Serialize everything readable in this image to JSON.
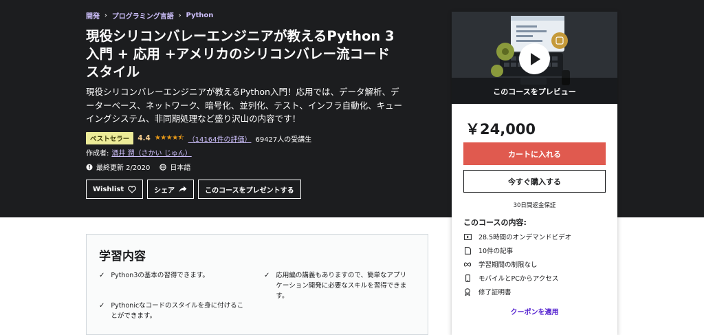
{
  "breadcrumb": [
    "開発",
    "プログラミング言語",
    "Python"
  ],
  "course": {
    "title_lines": [
      "現役シリコンバレーエンジニアが教えるPython 3",
      "入門 + 応用 +アメリカのシリコンバレー流コード",
      "スタイル"
    ],
    "subtitle_lines": [
      "現役シリコンバレーエンジニアが教えるPython入門！応用では、データ解析、デ",
      "ーターベース、ネットワーク、暗号化、並列化、テスト、インフラ自動化、キュー",
      "イングシステム、非同期処理など盛り沢山の内容です！"
    ],
    "badge": "ベストセラー",
    "rating": "4.4",
    "stars": "★★★★⯪",
    "reviews": "（14164件の評価）",
    "students": "69427人の受講生",
    "author_label": "作成者:",
    "author": "酒井 潤（さかい じゅん）",
    "updated": "最終更新 2/2020",
    "language": "日本語"
  },
  "actions": {
    "wishlist": "Wishlist",
    "share": "シェア",
    "gift": "このコースをプレゼントする"
  },
  "learn": {
    "title": "学習内容",
    "items": [
      [
        "Python3の基本の習得できます。"
      ],
      [
        "応用編の講義もありますので、簡単なアプリ",
        "ケーション開発に必要なスキルを習得できま",
        "す。"
      ],
      [
        "Pythonicなコードのスタイルを身に付けるこ",
        "とができます。"
      ]
    ]
  },
  "sidebar": {
    "preview_label": "このコースをプレビュー",
    "price": "￥24,000",
    "add_to_cart": "カートに入れる",
    "buy_now": "今すぐ購入する",
    "guarantee": "30日間返金保証",
    "includes_title": "このコースの内容:",
    "includes": [
      {
        "icon": "video-icon",
        "label": "28.5時間のオンデマンドビデオ"
      },
      {
        "icon": "article-icon",
        "label": "10件の記事"
      },
      {
        "icon": "infinity-icon",
        "label": "学習期間の制限なし"
      },
      {
        "icon": "mobile-icon",
        "label": "モバイルとPCからアクセス"
      },
      {
        "icon": "certificate-icon",
        "label": "修了証明書"
      }
    ],
    "coupon": "クーポンを適用"
  },
  "colors": {
    "hero_bg": "#1c1d1f",
    "link_purple": "#cec0fc",
    "cart_red": "#e05a4f",
    "coupon_purple": "#5624d0",
    "star_orange": "#e59819"
  }
}
